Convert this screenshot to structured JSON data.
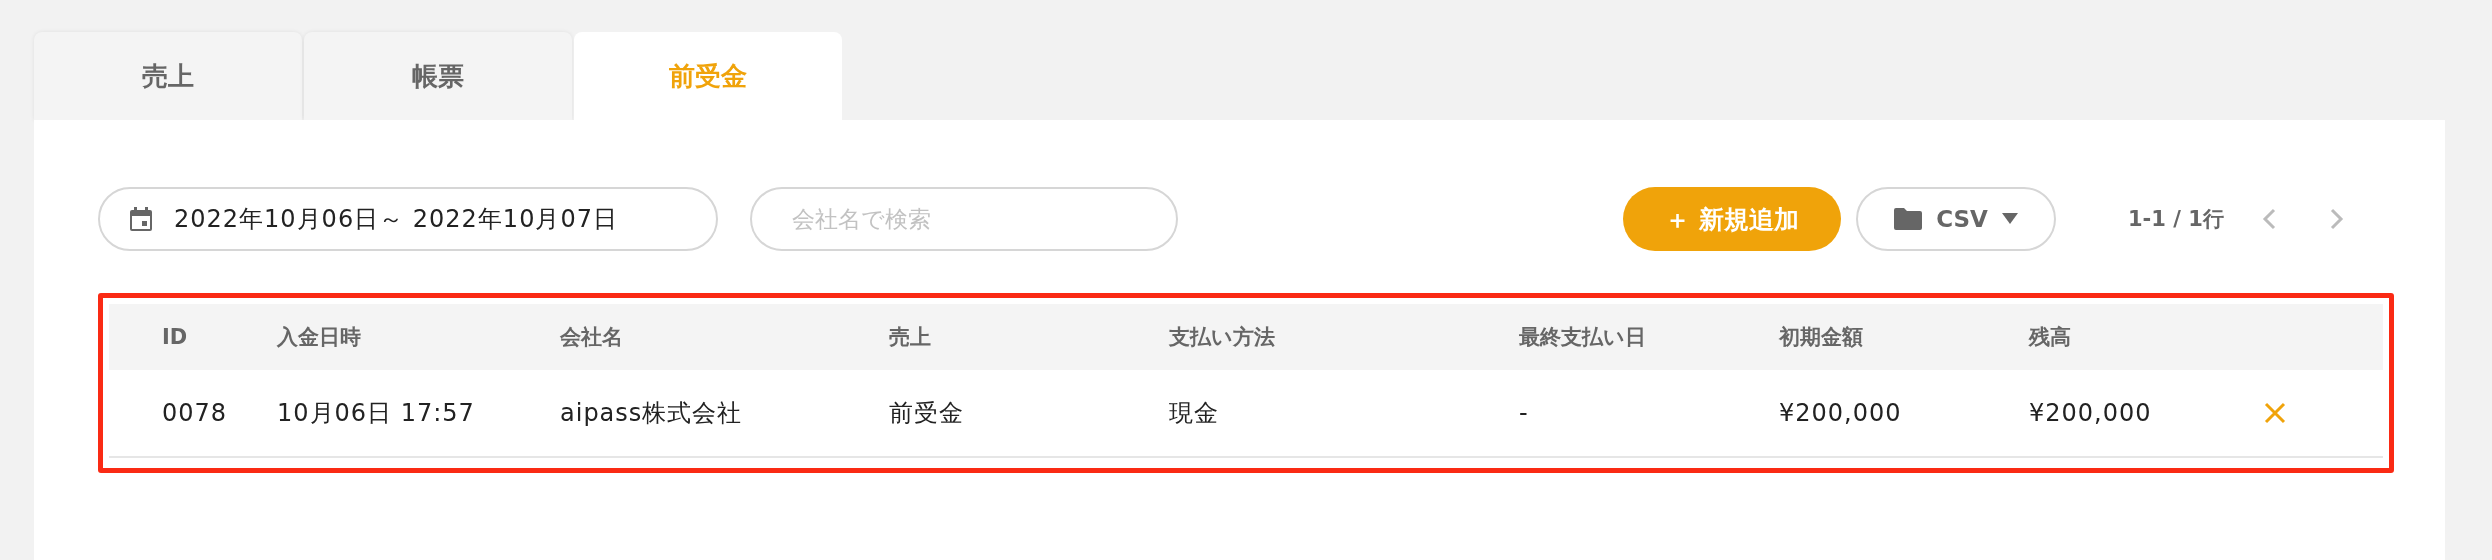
{
  "tabs": [
    {
      "label": "売上",
      "selected": false
    },
    {
      "label": "帳票",
      "selected": false
    },
    {
      "label": "前受金",
      "selected": true
    }
  ],
  "toolbar": {
    "date_range": "2022年10月06日～ 2022年10月07日",
    "search": {
      "placeholder": "会社名で検索"
    },
    "add_button": "＋ 新規追加",
    "csv_button": "CSV",
    "pagination": "1-1 / 1行"
  },
  "table": {
    "highlighted": true,
    "columns": [
      "ID",
      "入金日時",
      "会社名",
      "売上",
      "支払い方法",
      "最終支払い日",
      "初期金額",
      "残高"
    ],
    "rows": [
      {
        "cells": [
          "0078",
          "10月06日 17:57",
          "aipass株式会社",
          "前受金",
          "現金",
          "-",
          "¥200,000",
          "¥200,000"
        ]
      }
    ]
  }
}
